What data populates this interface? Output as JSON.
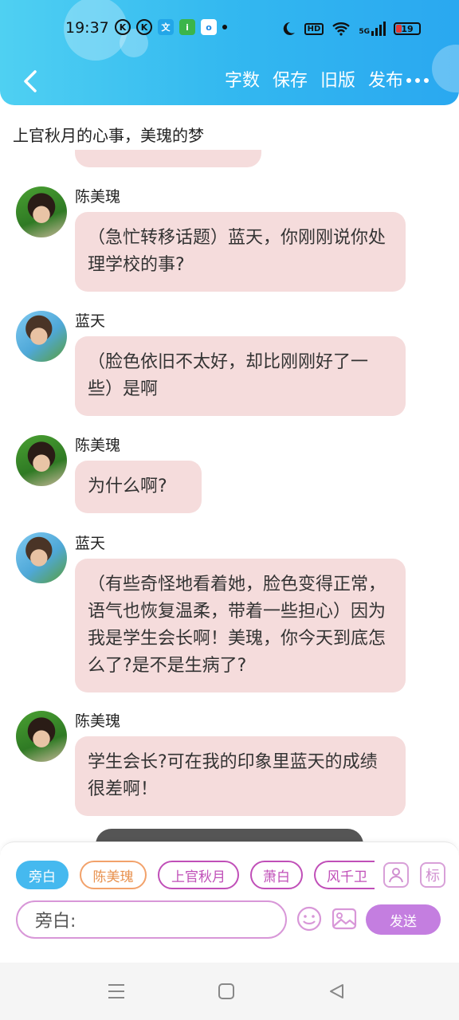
{
  "status_bar": {
    "time": "19:37",
    "app_icons": [
      "K",
      "K",
      "文",
      "i",
      "o"
    ],
    "hd": "HD",
    "signal_5g": "5G",
    "battery": "19"
  },
  "header": {
    "menu": [
      "字数",
      "保存",
      "旧版",
      "发布"
    ]
  },
  "story_title": "上官秋月的心事，美瑰的梦",
  "messages": [
    {
      "sender": "陈美瑰",
      "text": "（急忙转移话题）蓝天，你刚刚说你处理学校的事?"
    },
    {
      "sender": "蓝天",
      "text": "（脸色依旧不太好，却比刚刚好了一些）是啊"
    },
    {
      "sender": "陈美瑰",
      "text": "为什么啊?"
    },
    {
      "sender": "蓝天",
      "text": "（有些奇怪地看着她，脸色变得正常，语气也恢复温柔，带着一些担心）因为我是学生会长啊！美瑰，你今天到底怎么了?是不是生病了?"
    },
    {
      "sender": "陈美瑰",
      "text": "学生会长?可在我的印象里蓝天的成绩很差啊！"
    }
  ],
  "characters": [
    "旁白",
    "陈美瑰",
    "上官秋月",
    "萧白",
    "风千卫"
  ],
  "tools": {
    "icon_label": "标"
  },
  "composer": {
    "input_text": "旁白:",
    "send_label": "发送"
  },
  "colors": {
    "header_blue": "#33b8f0",
    "bubble_pink": "#f5dcdc",
    "active_chip": "#45b9ef",
    "send_purple": "#c47ee0"
  }
}
